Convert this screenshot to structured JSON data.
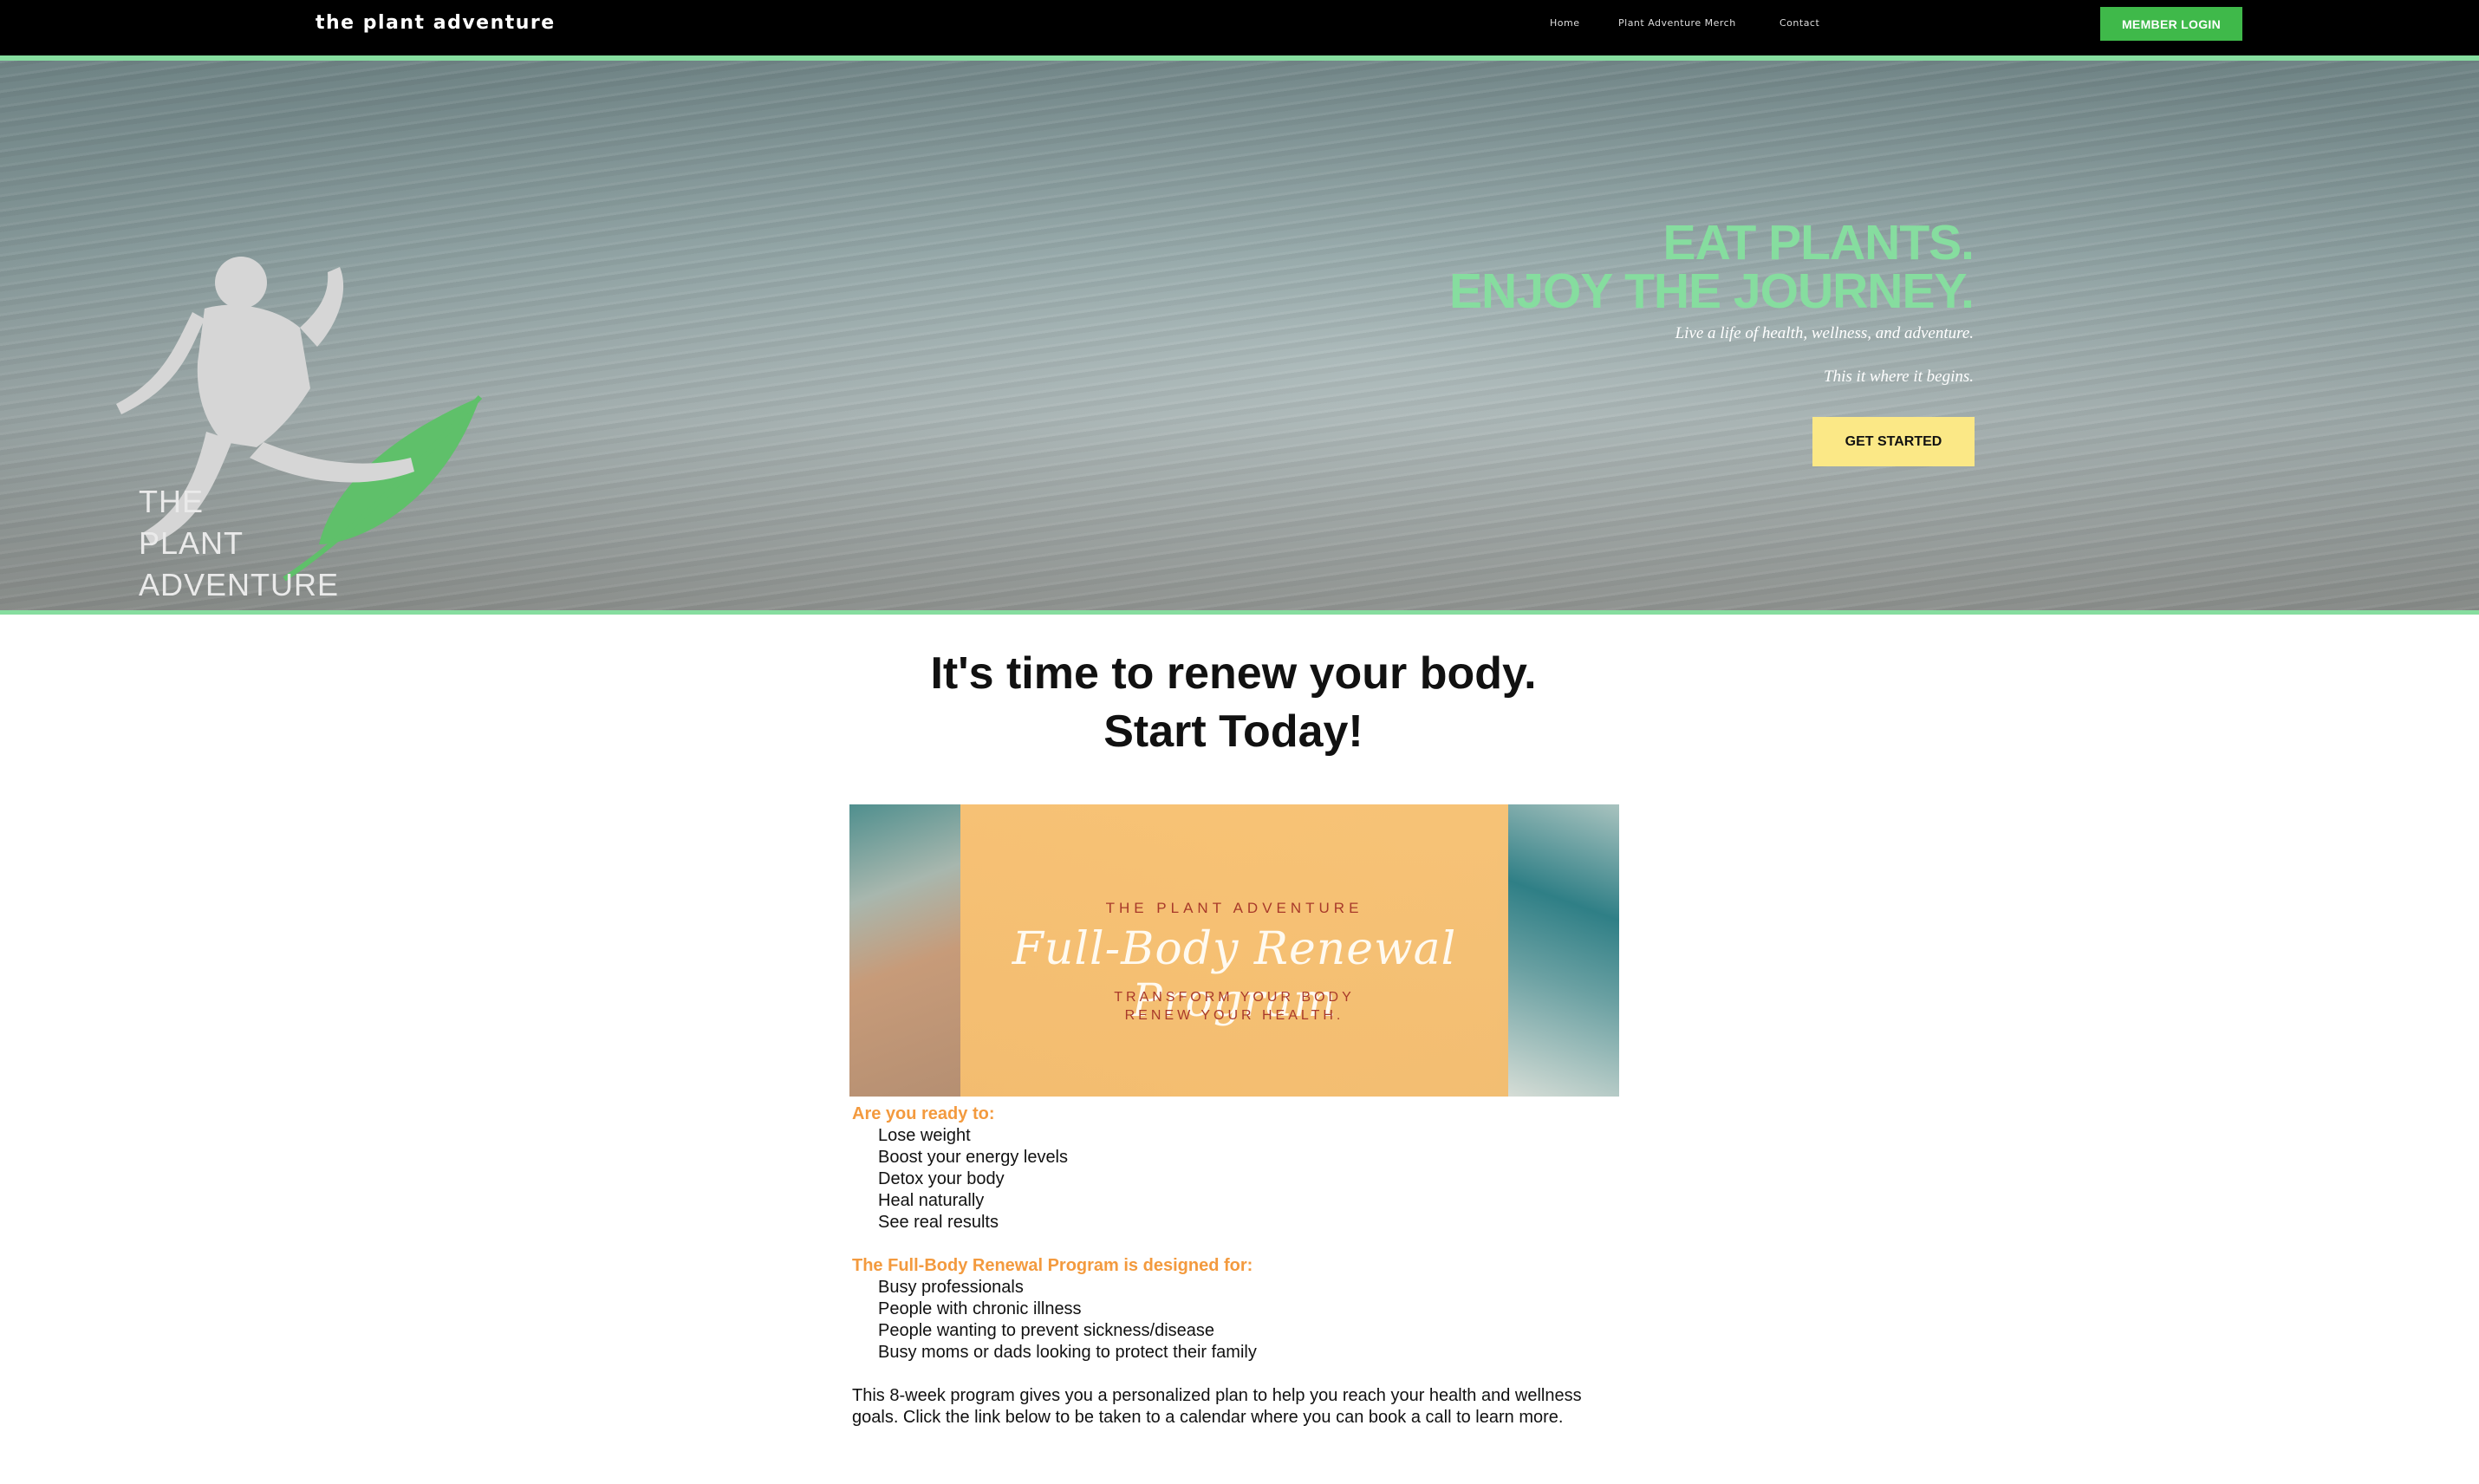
{
  "nav": {
    "brand": "the plant adventure",
    "links": [
      "Home",
      "Plant Adventure Merch",
      "Contact"
    ],
    "member_login": "MEMBER LOGIN"
  },
  "hero": {
    "logo_lines": [
      "THE",
      "PLANT",
      "ADVENTURE"
    ],
    "headline_1": "EAT PLANTS.",
    "headline_2": "ENJOY THE JOURNEY.",
    "tagline_1": "Live a life of health, wellness, and adventure.",
    "tagline_2": "This it where it begins.",
    "cta": "GET STARTED"
  },
  "main": {
    "title_1": "It's time to renew your body.",
    "title_2": "Start Today!",
    "banner": {
      "top": "THE PLANT ADVENTURE",
      "script": "Full-Body Renewal Program",
      "sub_1": "TRANSFORM YOUR BODY",
      "sub_2": "RENEW YOUR HEALTH."
    },
    "ready_heading": "Are you ready to:",
    "ready_items": [
      "Lose weight",
      "Boost your energy levels",
      "Detox your body",
      "Heal naturally",
      "See real results"
    ],
    "designed_heading": "The Full-Body Renewal Program is designed for:",
    "designed_items": [
      "Busy professionals",
      "People with chronic illness",
      "People wanting to prevent sickness/disease",
      "Busy moms or dads looking to protect their family"
    ],
    "paragraph": "This 8-week program gives you a personalized plan to help you reach your health and wellness goals. Click the link below to be taken to a calendar where you can book a call to learn more."
  }
}
